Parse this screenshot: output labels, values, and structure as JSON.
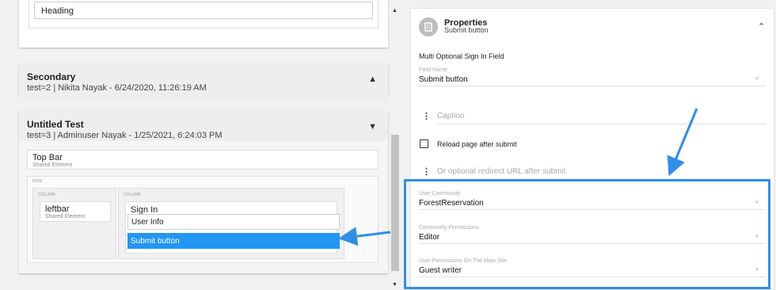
{
  "left": {
    "heading_card": {
      "heading_text": "Heading"
    },
    "secondary": {
      "title": "Secondary",
      "subtitle": "test=2 | Nikita Nayak - 6/24/2020, 11:26:19 AM"
    },
    "untitled": {
      "title": "Untitled Test",
      "subtitle": "test=3 | Adminuser Nayak - 1/25/2021, 6:24:03 PM",
      "top_bar": {
        "title": "Top Bar",
        "sub": "Shared Element"
      },
      "row_label": "ROW",
      "column_label": "COLUMN",
      "leftbar": {
        "title": "leftbar",
        "sub": "Shared Element"
      },
      "signin": {
        "title": "Sign In",
        "user_info": "User Info",
        "submit": "Submit button"
      }
    }
  },
  "properties": {
    "title": "Properties",
    "subtitle": "Submit button",
    "section_name": "Multi Optional Sign In Field",
    "field_name": {
      "label": "Field Name",
      "value": "Submit button"
    },
    "caption_placeholder": "Caption",
    "reload_label": "Reload page after submit",
    "redirect_placeholder": "Or optional redirect URL after submit",
    "user_community": {
      "label": "User Community",
      "value": "ForestReservation"
    },
    "community_permissions": {
      "label": "Community Permissions",
      "value": "Editor"
    },
    "main_site_permissions": {
      "label": "User Permissions On The Main Site",
      "value": "Guest writer"
    }
  },
  "icons": {
    "chevron_up": "chevron-up-icon",
    "chevron_down": "chevron-down-icon",
    "kebab": "more-vert-icon",
    "avatar": "user-avatar-icon"
  },
  "colors": {
    "accent": "#2196f3",
    "highlight": "#2f8fe8"
  }
}
